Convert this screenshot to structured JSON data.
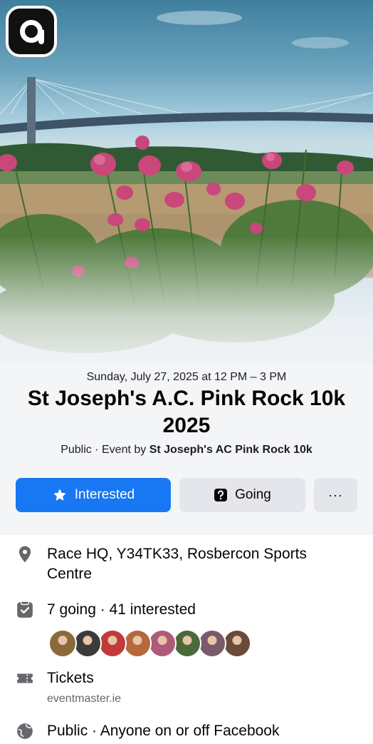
{
  "event": {
    "date_line": "Sunday, July 27, 2025 at 12 PM – 3 PM",
    "title": "St Joseph's A.C. Pink Rock 10k 2025",
    "byline_prefix": "Public · Event by ",
    "host": "St Joseph's  AC Pink Rock 10k"
  },
  "actions": {
    "interested_label": "Interested",
    "going_label": "Going",
    "more_label": "···"
  },
  "details": {
    "location": "Race HQ, Y34TK33, Rosbercon Sports Centre",
    "attendance": "7 going · 41 interested",
    "tickets_label": "Tickets",
    "tickets_link": "eventmaster.ie",
    "privacy": "Public · Anyone on or off Facebook"
  },
  "avatars": [
    {
      "name": "attendee-1",
      "color": "#8a6a3b"
    },
    {
      "name": "attendee-2",
      "color": "#3b3b3b"
    },
    {
      "name": "attendee-3",
      "color": "#c23a3a"
    },
    {
      "name": "attendee-4",
      "color": "#b5683a"
    },
    {
      "name": "attendee-5",
      "color": "#b05a7a"
    },
    {
      "name": "attendee-6",
      "color": "#4a6a3a"
    },
    {
      "name": "attendee-7",
      "color": "#7a5a6a"
    },
    {
      "name": "attendee-8",
      "color": "#6a4a3a"
    }
  ],
  "colors": {
    "primary": "#1877f2",
    "secondary_button": "#e4e6eb",
    "muted_text": "#65676b"
  },
  "icons": [
    "app-logo-icon",
    "star-icon",
    "going-icon",
    "location-pin-icon",
    "calendar-check-icon",
    "ticket-icon",
    "globe-icon"
  ]
}
